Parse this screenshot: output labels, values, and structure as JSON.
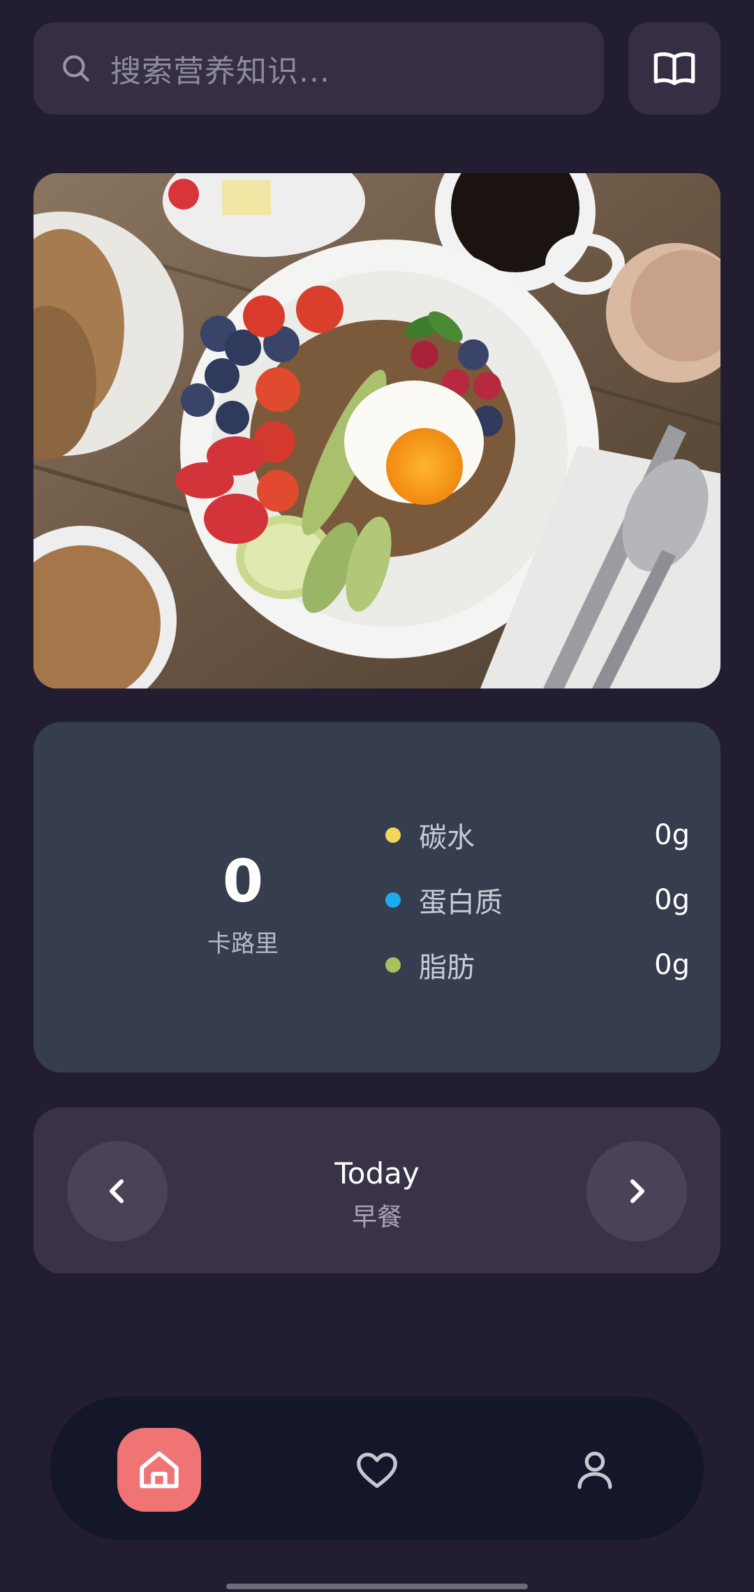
{
  "search": {
    "placeholder": "搜索营养知识..."
  },
  "icons": {
    "search": "search-icon",
    "book": "book-open-icon",
    "prev": "chevron-left-icon",
    "next": "chevron-right-icon",
    "home": "home-icon",
    "favorites": "heart-icon",
    "profile": "user-icon"
  },
  "hero": {
    "image": "breakfast plate with fruit, egg and cucumber"
  },
  "nutrition": {
    "calories_value": "0",
    "calories_label": "卡路里",
    "macros": [
      {
        "name": "碳水",
        "value": "0g",
        "color": "#f3d75a"
      },
      {
        "name": "蛋白质",
        "value": "0g",
        "color": "#1fa9ef"
      },
      {
        "name": "脂肪",
        "value": "0g",
        "color": "#a8c15b"
      }
    ]
  },
  "day_selector": {
    "title": "Today",
    "meal": "早餐"
  },
  "bottom_nav": {
    "active": "home",
    "active_color": "#f07474"
  }
}
